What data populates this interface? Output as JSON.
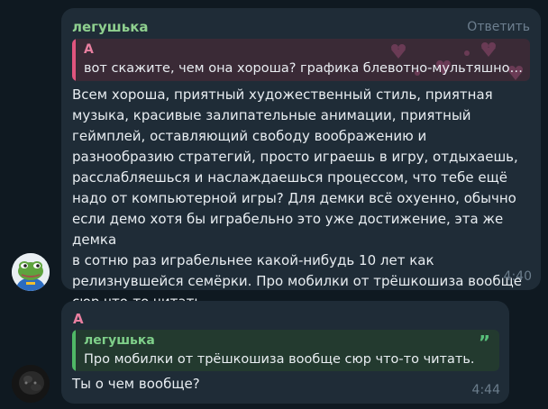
{
  "colors": {
    "background": "#0f1921",
    "bubble": "#1f2c37",
    "sender_green": "#8fd08f",
    "sender_pink": "#e87fa0",
    "reply_link": "#6d7f8f",
    "quote_pink_bg": "#3a2a36",
    "quote_pink_bar": "#e0557e",
    "quote_green_bg": "#233a2f",
    "quote_green_bar": "#4fb866"
  },
  "messages": [
    {
      "sender": "легушька",
      "reply_label": "Ответить",
      "quote": {
        "author": "A",
        "text": "вот скажите, чем она хороша? графика блевотно-мультяшно…"
      },
      "text": "Всем хороша, приятный художественный стиль, приятная\nмузыка, красивые залипательные анимации, приятный\nгеймплей, оставляющий свободу воображению и\nразнообразию стратегий, просто играешь в игру, отдыхаешь,\nрасслабляешься и наслаждаешься процессом, что тебе ещё\nнадо от компьютерной игры? Для демки всё охуенно, обычно\nесли демо хотя бы играбельно это уже достижение, эта же демка\nв сотню раз играбельнее какой-нибудь 10 лет как\nрелизнувшейся семёрки. Про мобилки от трёшкошиза вообще\nсюр что-то читать.",
      "time": "4:40",
      "avatar": "frog-avatar-icon"
    },
    {
      "sender": "A",
      "quote": {
        "author": "легушька",
        "text": "Про мобилки от трёшкошиза вообще сюр что-то читать.",
        "mark": "”"
      },
      "text": "Ты о чем вообще?",
      "time": "4:44",
      "avatar": "dark-user-avatar-icon"
    }
  ]
}
